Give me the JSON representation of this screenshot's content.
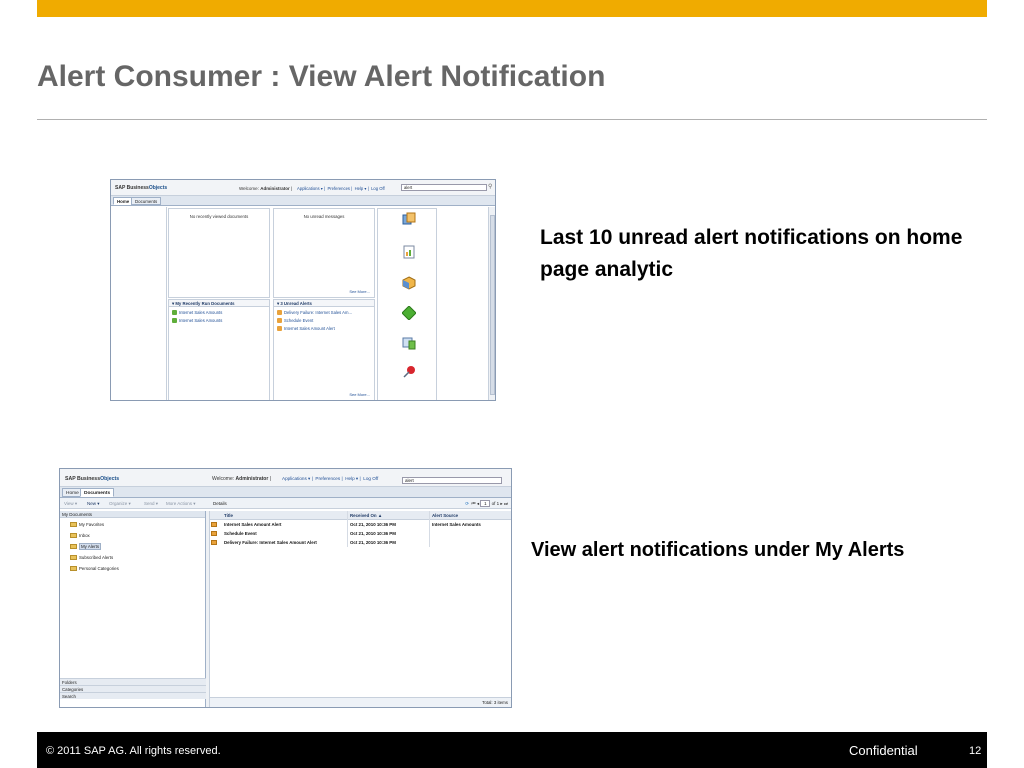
{
  "slide": {
    "title": "Alert Consumer : View Alert Notification",
    "caption_top": "Last 10 unread alert notifications on home page analytic",
    "caption_bottom": "View alert notifications under My Alerts",
    "footer_copyright": "©  2011 SAP AG. All rights reserved.",
    "footer_confidential": "Confidential",
    "page_number": "12",
    "colors": {
      "accent_bar": "#f0ab00",
      "title": "#666666",
      "footer_bg": "#000000"
    }
  },
  "home_screenshot": {
    "logo_prefix": "SAP Business",
    "logo_suffix": "Objects",
    "welcome_label": "Welcome:",
    "user": "Administrator",
    "nav": [
      "Applications ▾",
      "Preferences",
      "Help ▾",
      "Log Off"
    ],
    "search_value": "alert",
    "tabs": [
      "Home",
      "Documents"
    ],
    "panel_recent_viewed_empty": "No recently viewed documents",
    "panel_unread_messages_empty": "No unread messages",
    "see_more": "See More...",
    "recent_run_header": "▾  My Recently Run Documents",
    "recent_run_items": [
      "Internet Sales Amounts",
      "Internet Sales Amounts"
    ],
    "unread_alerts_header": "▾  3 Unread Alerts",
    "unread_alerts_items": [
      "Delivery Failure: Internet Sales Am...",
      "Schedule Event",
      "Internet Sales Amount Alert"
    ],
    "icon_names": [
      "documents-stack-icon",
      "report-icon",
      "cube-icon",
      "green-diamond-icon",
      "analytics-icon",
      "pin-icon"
    ]
  },
  "documents_screenshot": {
    "logo_prefix": "SAP Business",
    "logo_suffix": "Objects",
    "welcome_label": "Welcome:",
    "user": "Administrator",
    "nav": [
      "Applications ▾",
      "Preferences",
      "Help ▾",
      "Log Off"
    ],
    "search_value": "alert",
    "tabs": [
      "Home",
      "Documents"
    ],
    "toolbar": [
      "View ▾",
      "New ▾",
      "Organize ▾",
      "Send ▾",
      "More Actions ▾",
      "Details"
    ],
    "pager_page": "1",
    "pager_of": "of 1",
    "tree_header": "My Documents",
    "tree_items": [
      "My Favorites",
      "Inbox",
      "My Alerts",
      "Subscribed Alerts",
      "Personal Categories"
    ],
    "accordion": [
      "Folders",
      "Categories",
      "Search"
    ],
    "grid_columns": [
      "Title",
      "Received On ▲",
      "Alert Source"
    ],
    "grid_rows": [
      [
        "Internet Sales Amount Alert",
        "Oct 21, 2010 10:36 PM",
        "Internet Sales Amounts"
      ],
      [
        "Schedule Event",
        "Oct 21, 2010 10:36 PM",
        ""
      ],
      [
        "Delivery Failure: Internet Sales Amount Alert",
        "Oct 21, 2010 10:36 PM",
        ""
      ]
    ],
    "status": "Total: 3 items"
  }
}
